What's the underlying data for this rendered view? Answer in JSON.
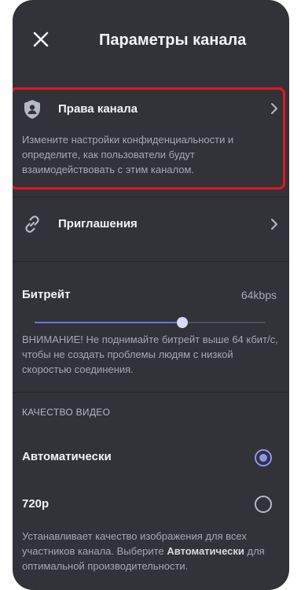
{
  "header": {
    "title": "Параметры канала",
    "close_icon": "close-icon"
  },
  "permissions": {
    "label": "Права канала",
    "icon": "shield-person-icon",
    "description": "Измените настройки конфиденциальности и определите, как пользователи будут взаимодействовать с этим каналом.",
    "highlight_color": "#e4161e"
  },
  "invites": {
    "label": "Приглашения",
    "icon": "link-icon"
  },
  "bitrate": {
    "label": "Битрейт",
    "value": "64kbps",
    "slider_fraction": 0.64,
    "warning": "ВНИМАНИЕ! Не поднимайте битрейт выше 64 кбит/с, чтобы не создать проблемы людям с низкой скоростью соединения."
  },
  "video_quality": {
    "section_label": "КАЧЕСТВО ВИДЕО",
    "options": [
      {
        "label": "Автоматически",
        "selected": true
      },
      {
        "label": "720p",
        "selected": false
      }
    ],
    "description_before": "Устанавливает качество изображения для всех участников канала. Выберите ",
    "description_bold": "Автоматически",
    "description_after": " для оптимальной производительности."
  },
  "colors": {
    "background": "#313338",
    "accent": "#8e95f5",
    "slider": "#6b73e0"
  }
}
